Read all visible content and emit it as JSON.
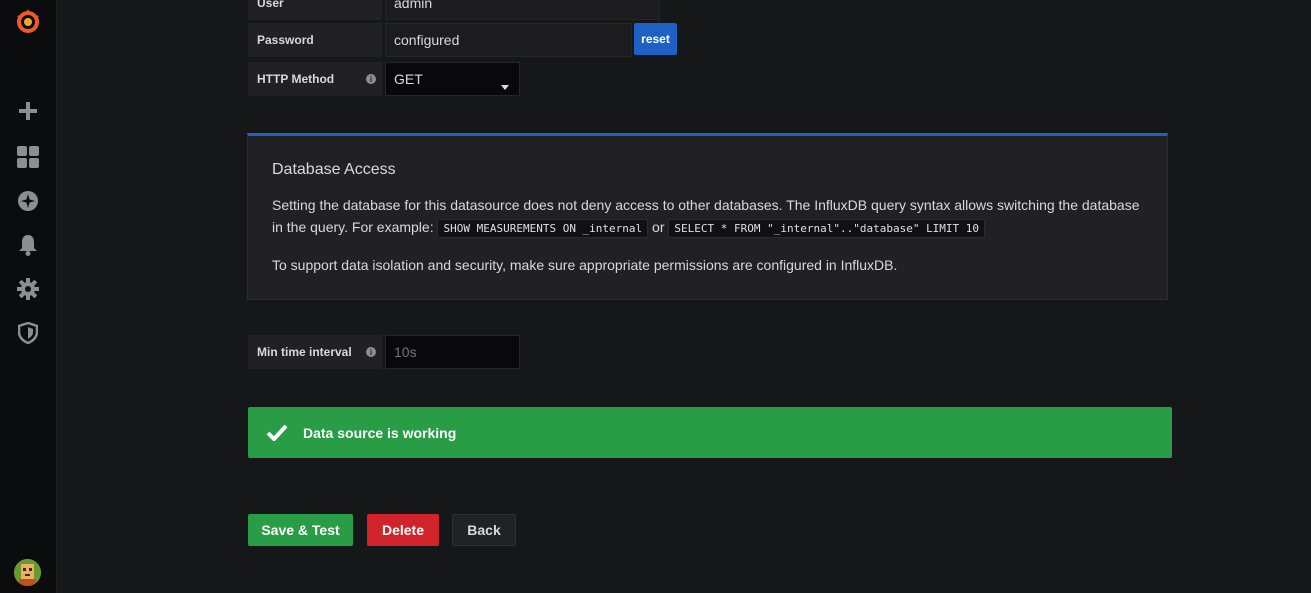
{
  "sidebar": {
    "items": [
      {
        "icon": "grafana-logo-icon"
      },
      {
        "icon": "plus-icon"
      },
      {
        "icon": "dashboards-icon"
      },
      {
        "icon": "explore-compass-icon"
      },
      {
        "icon": "bell-alerting-icon"
      },
      {
        "icon": "gear-icon"
      },
      {
        "icon": "shield-icon"
      }
    ],
    "avatar_icon": "user-avatar"
  },
  "auth": {
    "user_label": "User",
    "user_value": "admin",
    "password_label": "Password",
    "password_value": "configured",
    "reset_label": "reset",
    "http_method_label": "HTTP Method",
    "http_method_value": "GET"
  },
  "db_access": {
    "title": "Database Access",
    "text_part1": "Setting the database for this datasource does not deny access to other databases. The InfluxDB query syntax allows switching the database in the query. For example: ",
    "code1": "SHOW MEASUREMENTS ON _internal",
    "or_text": " or ",
    "code2": "SELECT * FROM \"_internal\"..\"database\" LIMIT 10",
    "text2": "To support data isolation and security, make sure appropriate permissions are configured in InfluxDB."
  },
  "min_interval": {
    "label": "Min time interval",
    "placeholder": "10s"
  },
  "alert": {
    "message": "Data source is working",
    "color": "#299c46"
  },
  "actions": {
    "save_label": "Save & Test",
    "delete_label": "Delete",
    "back_label": "Back"
  },
  "colors": {
    "accent": "#1f60c4",
    "success": "#299c46",
    "danger": "#d1232c"
  }
}
